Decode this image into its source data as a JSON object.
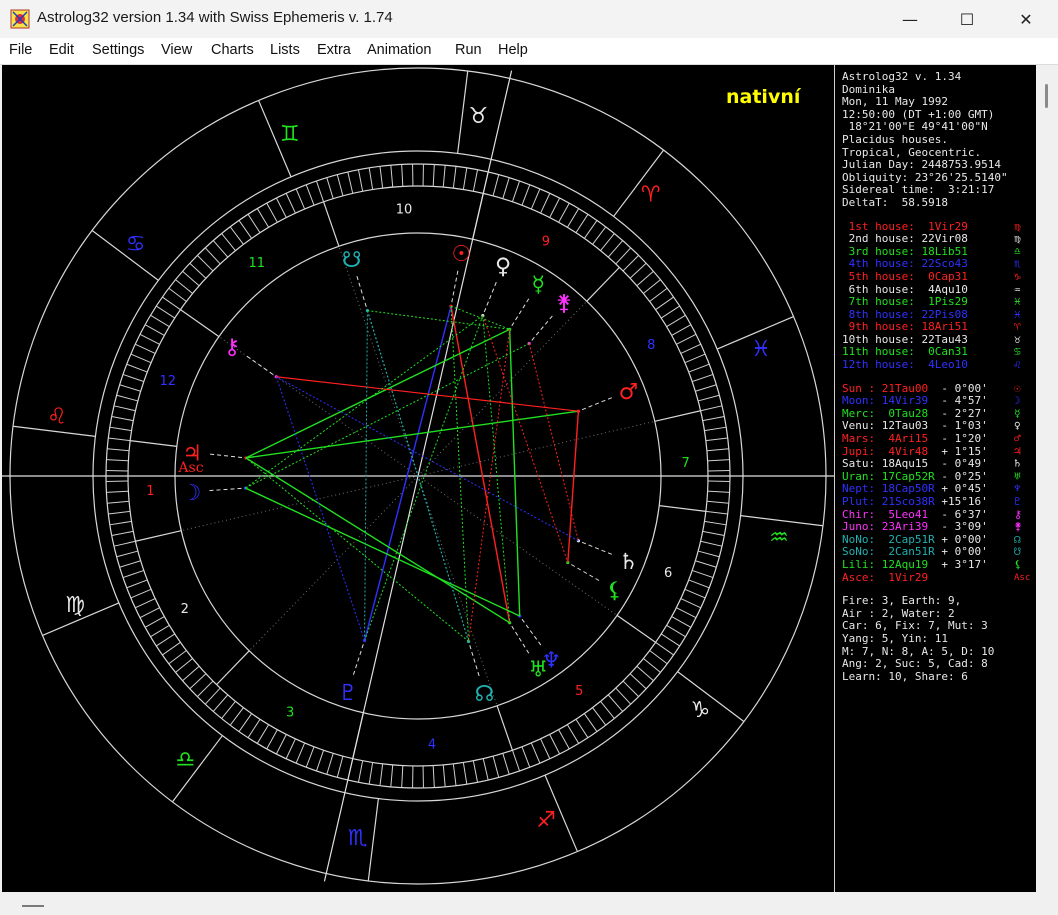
{
  "window": {
    "title": "Astrolog32 version 1.34 with Swiss Ephemeris v. 1.74",
    "minimize": "—",
    "maximize": "☐",
    "close": "✕"
  },
  "menu": [
    "File",
    "Edit",
    "Settings",
    "View",
    "Charts",
    "Lists",
    "Extra",
    "Animation",
    "Run",
    "Help"
  ],
  "chart_title": "nativní",
  "info": [
    "Astrolog32 v. 1.34",
    "Dominika",
    "Mon, 11 May 1992",
    "12:50:00 (DT +1:00 GMT)",
    " 18°21'00\"E 49°41'00\"N",
    "Placidus houses.",
    "Tropical, Geocentric.",
    "Julian Day: 2448753.9514",
    "Obliquity: 23°26'25.5140\"",
    "Sidereal time:  3:21:17",
    "DeltaT:  58.5918"
  ],
  "houses": [
    {
      "label": "1st house:",
      "value": " 1Vir29",
      "symbol": "♍",
      "color": "#ff2020"
    },
    {
      "label": "2nd house:",
      "value": "22Vir08",
      "symbol": "♍",
      "color": "#e8e8e8"
    },
    {
      "label": "3rd house:",
      "value": "18Lib51",
      "symbol": "♎",
      "color": "#20e020"
    },
    {
      "label": "4th house:",
      "value": "22Sco43",
      "symbol": "♏",
      "color": "#3030ff"
    },
    {
      "label": "5th house:",
      "value": " 0Cap31",
      "symbol": "♑",
      "color": "#ff2020"
    },
    {
      "label": "6th house:",
      "value": " 4Aqu10",
      "symbol": "♒",
      "color": "#e8e8e8"
    },
    {
      "label": "7th house:",
      "value": " 1Pis29",
      "symbol": "♓",
      "color": "#20e020"
    },
    {
      "label": "8th house:",
      "value": "22Pis08",
      "symbol": "♓",
      "color": "#3030ff"
    },
    {
      "label": "9th house:",
      "value": "18Ari51",
      "symbol": "♈",
      "color": "#ff2020"
    },
    {
      "label": "10th house:",
      "value": "22Tau43",
      "symbol": "♉",
      "color": "#e8e8e8"
    },
    {
      "label": "11th house:",
      "value": " 0Can31",
      "symbol": "♋",
      "color": "#20e020"
    },
    {
      "label": "12th house:",
      "value": " 4Leo10",
      "symbol": "♌",
      "color": "#3030ff"
    }
  ],
  "planets": [
    {
      "name": "Sun :",
      "pos": "21Tau00 ",
      "lat": " - 0°00'",
      "symbol": "☉",
      "color": "#ff2020"
    },
    {
      "name": "Moon:",
      "pos": "14Vir39 ",
      "lat": " - 4°57'",
      "symbol": "☽",
      "color": "#3030ff"
    },
    {
      "name": "Merc:",
      "pos": " 0Tau28 ",
      "lat": " - 2°27'",
      "symbol": "☿",
      "color": "#20e020"
    },
    {
      "name": "Venu:",
      "pos": "12Tau03 ",
      "lat": " - 1°03'",
      "symbol": "♀",
      "color": "#e8e8e8"
    },
    {
      "name": "Mars:",
      "pos": " 4Ari15 ",
      "lat": " - 1°20'",
      "symbol": "♂",
      "color": "#ff2020"
    },
    {
      "name": "Jupi:",
      "pos": " 4Vir48 ",
      "lat": " + 1°15'",
      "symbol": "♃",
      "color": "#ff2020"
    },
    {
      "name": "Satu:",
      "pos": "18Aqu15 ",
      "lat": " - 0°49'",
      "symbol": "♄",
      "color": "#e8e8e8"
    },
    {
      "name": "Uran:",
      "pos": "17Cap52R",
      "lat": " - 0°25'",
      "symbol": "♅",
      "color": "#20e020"
    },
    {
      "name": "Nept:",
      "pos": "18Cap50R",
      "lat": " + 0°45'",
      "symbol": "♆",
      "color": "#3030ff"
    },
    {
      "name": "Plut:",
      "pos": "21Sco38R",
      "lat": " +15°16'",
      "symbol": "♇",
      "color": "#3030ff"
    },
    {
      "name": "Chir:",
      "pos": " 5Leo41 ",
      "lat": " - 6°37'",
      "symbol": "⚷",
      "color": "#ff30ff"
    },
    {
      "name": "Juno:",
      "pos": "23Ari39 ",
      "lat": " - 3°09'",
      "symbol": "⚵",
      "color": "#ff30ff"
    },
    {
      "name": "NoNo:",
      "pos": " 2Cap51R",
      "lat": " + 0°00'",
      "symbol": "☊",
      "color": "#20b0b0"
    },
    {
      "name": "SoNo:",
      "pos": " 2Can51R",
      "lat": " + 0°00'",
      "symbol": "☋",
      "color": "#20b0b0"
    },
    {
      "name": "Lili:",
      "pos": "12Aqu19 ",
      "lat": " + 3°17'",
      "symbol": "⚸",
      "color": "#20e020"
    },
    {
      "name": "Asce:",
      "pos": " 1Vir29",
      "lat": "",
      "symbol": "Asc",
      "color": "#ff2020"
    }
  ],
  "stats": [
    "Fire: 3, Earth: 9,",
    "Air : 2, Water: 2",
    "Car: 6, Fix: 7, Mut: 3",
    "Yang: 5, Yin: 11",
    "M: 7, N: 8, A: 5, D: 10",
    "Ang: 2, Suc: 5, Cad: 8",
    "Learn: 10, Share: 6"
  ],
  "wheel": {
    "asc_label": "Asc",
    "signs": [
      {
        "glyph": "♈",
        "color": "#ff2020"
      },
      {
        "glyph": "♉",
        "color": "#e8e8e8"
      },
      {
        "glyph": "♊",
        "color": "#20e020"
      },
      {
        "glyph": "♋",
        "color": "#3030ff"
      },
      {
        "glyph": "♌",
        "color": "#ff2020"
      },
      {
        "glyph": "♍",
        "color": "#e8e8e8"
      },
      {
        "glyph": "♎",
        "color": "#20e020"
      },
      {
        "glyph": "♏",
        "color": "#3030ff"
      },
      {
        "glyph": "♐",
        "color": "#ff2020"
      },
      {
        "glyph": "♑",
        "color": "#e8e8e8"
      },
      {
        "glyph": "♒",
        "color": "#20e020"
      },
      {
        "glyph": "♓",
        "color": "#3030ff"
      }
    ],
    "house_numbers": [
      {
        "n": "1",
        "color": "#ff2020"
      },
      {
        "n": "2",
        "color": "#e8e8e8"
      },
      {
        "n": "3",
        "color": "#20e020"
      },
      {
        "n": "4",
        "color": "#3030ff"
      },
      {
        "n": "5",
        "color": "#ff2020"
      },
      {
        "n": "6",
        "color": "#e8e8e8"
      },
      {
        "n": "7",
        "color": "#20e020"
      },
      {
        "n": "8",
        "color": "#3030ff"
      },
      {
        "n": "9",
        "color": "#ff2020"
      },
      {
        "n": "10",
        "color": "#e8e8e8"
      },
      {
        "n": "11",
        "color": "#20e020"
      },
      {
        "n": "12",
        "color": "#3030ff"
      }
    ]
  }
}
